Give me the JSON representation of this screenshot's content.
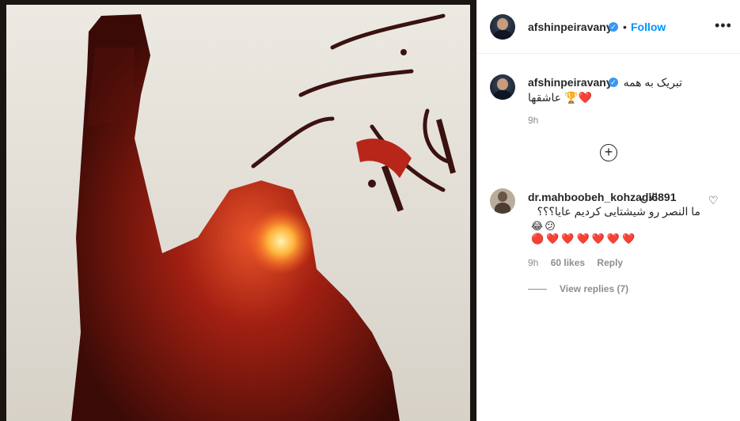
{
  "post": {
    "username": "afshinpeiravany",
    "follow_label": "Follow",
    "dot": "•",
    "more_label": "•••",
    "verified_glyph": "✓"
  },
  "caption": {
    "username": "afshinpeiravany",
    "line1": "تبریک به همه",
    "line2": "عاشقها 🏆❤️",
    "time": "9h"
  },
  "load_more": {
    "icon": "plus-circle-icon",
    "label": "+"
  },
  "comment": {
    "username": "dr.mahboobeh_kohzadi6891",
    "line1": "الان",
    "line2": "ما النصر رو شیشتایی کردیم عایا؟؟؟",
    "emoji_line1": "😂😕",
    "emoji_line2": "🔴❤️❤️❤️❤️❤️❤️",
    "time": "9h",
    "likes": "60 likes",
    "reply": "Reply",
    "heart": "♡"
  },
  "replies": {
    "label": "View replies (7)"
  },
  "colors": {
    "accent": "#0095f6",
    "verified": "#3897f0",
    "muted": "#8e8e8e"
  }
}
